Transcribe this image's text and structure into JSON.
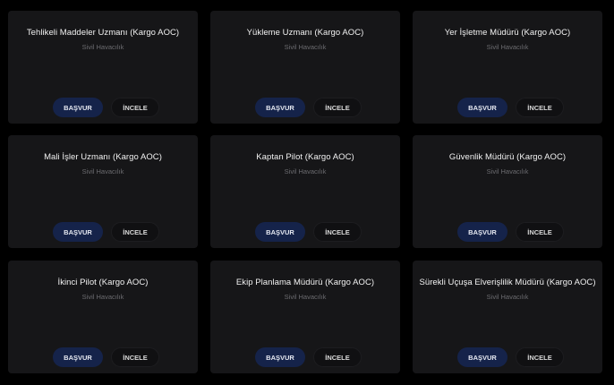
{
  "jobs": [
    {
      "title": "Tehlikeli Maddeler Uzmanı (Kargo AOC)",
      "category": "Sivil Havacılık",
      "apply_label": "BAŞVUR",
      "review_label": "İNCELE"
    },
    {
      "title": "Yükleme Uzmanı (Kargo AOC)",
      "category": "Sivil Havacılık",
      "apply_label": "BAŞVUR",
      "review_label": "İNCELE"
    },
    {
      "title": "Yer İşletme Müdürü (Kargo AOC)",
      "category": "Sivil Havacılık",
      "apply_label": "BAŞVUR",
      "review_label": "İNCELE"
    },
    {
      "title": "Mali İşler Uzmanı (Kargo AOC)",
      "category": "Sivil Havacılık",
      "apply_label": "BAŞVUR",
      "review_label": "İNCELE"
    },
    {
      "title": "Kaptan Pilot (Kargo AOC)",
      "category": "Sivil Havacılık",
      "apply_label": "BAŞVUR",
      "review_label": "İNCELE"
    },
    {
      "title": "Güvenlik Müdürü (Kargo AOC)",
      "category": "Sivil Havacılık",
      "apply_label": "BAŞVUR",
      "review_label": "İNCELE"
    },
    {
      "title": "İkinci Pilot (Kargo AOC)",
      "category": "Sivil Havacılık",
      "apply_label": "BAŞVUR",
      "review_label": "İNCELE"
    },
    {
      "title": "Ekip Planlama Müdürü (Kargo AOC)",
      "category": "Sivil Havacılık",
      "apply_label": "BAŞVUR",
      "review_label": "İNCELE"
    },
    {
      "title": "Sürekli Uçuşa Elverişlilik Müdürü (Kargo AOC)",
      "category": "Sivil Havacılık",
      "apply_label": "BAŞVUR",
      "review_label": "İNCELE"
    }
  ],
  "colors": {
    "page_background": "#000000",
    "card_background": "#161618",
    "apply_button": "#15234a",
    "review_button": "#101012",
    "title_text": "#f2f2f2",
    "subtitle_text": "#6c6c70"
  }
}
